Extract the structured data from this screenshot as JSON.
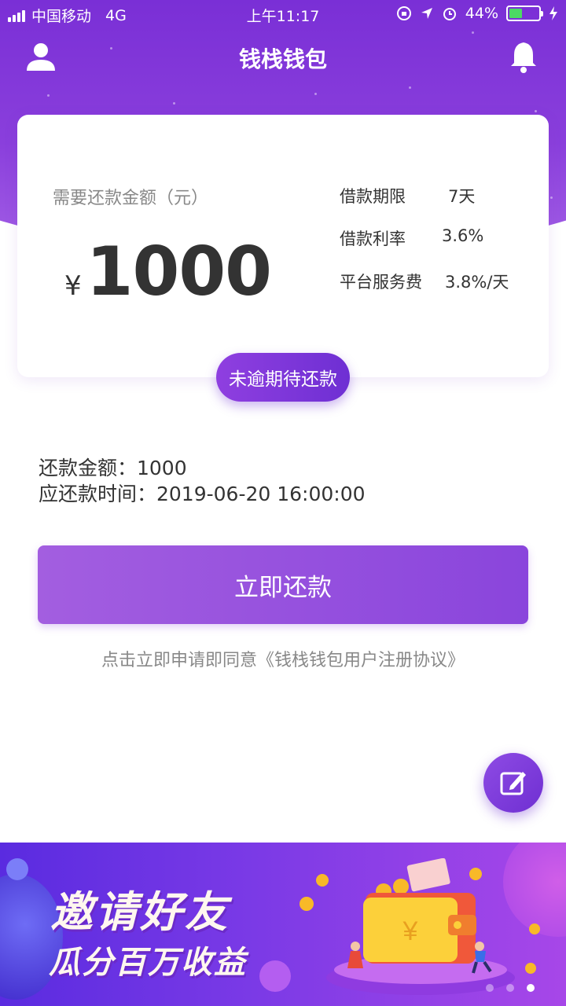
{
  "status_bar": {
    "carrier": "中国移动",
    "network": "4G",
    "time": "上午11:17",
    "battery_text": "44%",
    "battery_level": 0.44
  },
  "nav": {
    "title": "钱栈钱包",
    "user_icon": "user-icon",
    "bell_icon": "bell-icon"
  },
  "card": {
    "amount_label": "需要还款金额（元）",
    "currency_symbol": "¥",
    "amount": "1000",
    "info": [
      {
        "label": "借款期限",
        "value": "7天"
      },
      {
        "label": "借款利率",
        "value": "3.6%"
      },
      {
        "label": "平台服务费",
        "value": "3.8%/天"
      }
    ],
    "status": "未逾期待还款"
  },
  "details": {
    "repay_amount": "还款金额：1000",
    "repay_time": "应还款时间：2019-06-20 16:00:00"
  },
  "actions": {
    "pay_label": "立即还款",
    "agreement": "点击立即申请即同意《钱栈钱包用户注册协议》"
  },
  "banner": {
    "line1": "邀请好友",
    "line2": "瓜分百万收益",
    "wallet_symbol": "¥",
    "page_count": 3,
    "active_index": 2
  },
  "colors": {
    "primary": "#7a2fd6",
    "accent": "#8a45dc",
    "battery": "#4cd964"
  }
}
